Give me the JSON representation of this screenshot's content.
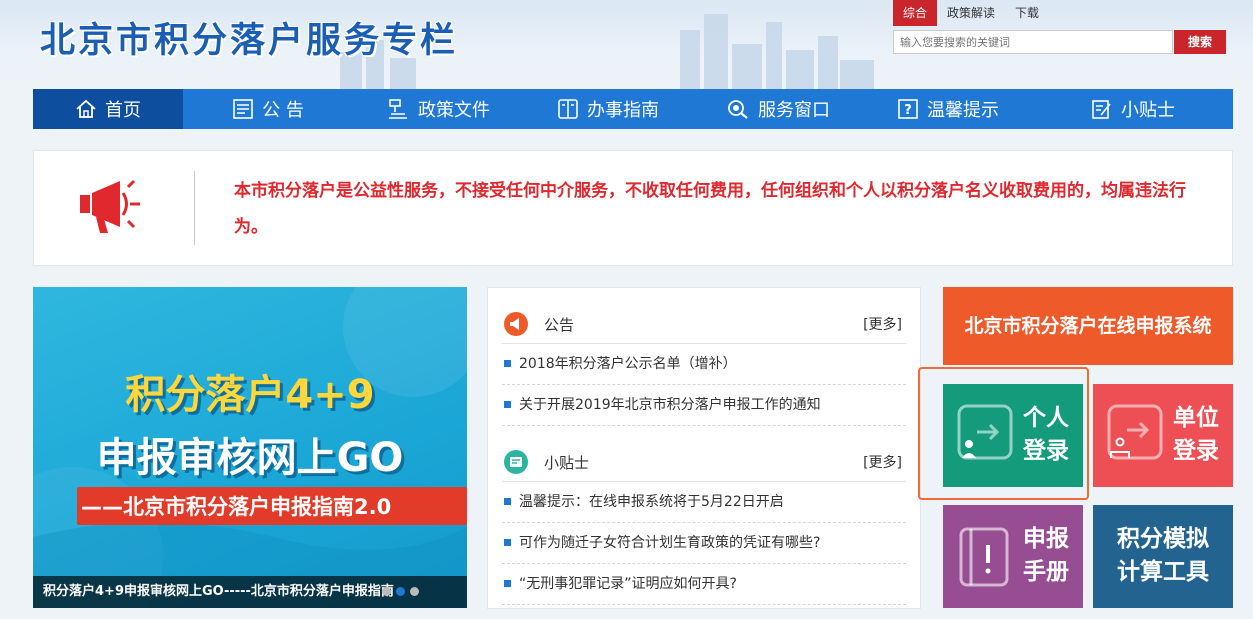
{
  "header": {
    "site_title": "北京市积分落户服务专栏",
    "top_tabs": [
      {
        "label": "综合"
      },
      {
        "label": "政策解读"
      },
      {
        "label": "下载"
      }
    ],
    "search": {
      "placeholder": "输入您要搜索的关键词",
      "button_label": "搜索"
    }
  },
  "nav": {
    "items": [
      {
        "label": "首页",
        "icon": "home-icon"
      },
      {
        "label": "公 告",
        "icon": "notice-board-icon"
      },
      {
        "label": "政策文件",
        "icon": "gavel-icon"
      },
      {
        "label": "办事指南",
        "icon": "guide-book-icon"
      },
      {
        "label": "服务窗口",
        "icon": "service-search-icon"
      },
      {
        "label": "温馨提示",
        "icon": "question-icon"
      },
      {
        "label": "小贴士",
        "icon": "edit-note-icon"
      }
    ]
  },
  "notice": {
    "icon": "megaphone-icon",
    "text": "本市积分落户是公益性服务，不接受任何中介服务，不收取任何费用，任何组织和个人以积分落户名义收取费用的，均属违法行为。"
  },
  "banner": {
    "line1": "积分落户4+9",
    "line2": "申报审核网上GO",
    "line3": "——北京市积分落户申报指南2.0",
    "caption": "积分落户4+9申报审核网上GO-----北京市积分落户申报指南"
  },
  "announcements": {
    "title": "公告",
    "more": "[更多]",
    "items": [
      {
        "text": "2018年积分落户公示名单（增补）"
      },
      {
        "text": "关于开展2019年北京市积分落户申报工作的通知"
      }
    ]
  },
  "tips": {
    "title": "小贴士",
    "more": "[更多]",
    "items": [
      {
        "text": "温馨提示：在线申报系统将于5月22日开启"
      },
      {
        "text": "可作为随迁子女符合计划生育政策的凭证有哪些?"
      },
      {
        "text": "“无刑事犯罪记录”证明应如何开具?"
      }
    ]
  },
  "tiles": {
    "online": {
      "label": "北京市积分落户在线申报系统"
    },
    "personal": {
      "line1": "个人",
      "line2": "登录"
    },
    "unit": {
      "line1": "单位",
      "line2": "登录"
    },
    "manual": {
      "line1": "申报",
      "line2": "手册"
    },
    "calc": {
      "line1": "积分模拟",
      "line2": "计算工具"
    }
  },
  "colors": {
    "brand_blue": "#1e78d4",
    "nav_active": "#0d4f9e",
    "alert_red": "#e0282e",
    "online_tile": "#ef5a2a",
    "personal_tile": "#139b7c",
    "unit_tile": "#ee4f55",
    "manual_tile": "#974d92",
    "calc_tile": "#23638f"
  }
}
